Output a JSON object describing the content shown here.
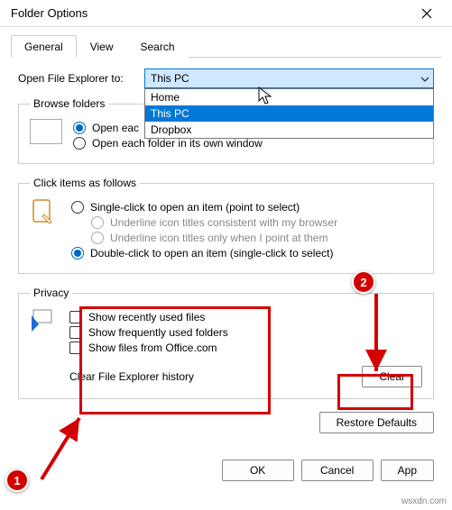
{
  "window": {
    "title": "Folder Options"
  },
  "tabs": {
    "general": "General",
    "view": "View",
    "search": "Search"
  },
  "open_row": {
    "label": "Open File Explorer to:",
    "selected": "This PC",
    "options": [
      "Home",
      "This PC",
      "Dropbox"
    ]
  },
  "browse": {
    "legend": "Browse folders",
    "same": "Open eac",
    "own": "Open each folder in its own window"
  },
  "click": {
    "legend": "Click items as follows",
    "single": "Single-click to open an item (point to select)",
    "underline_browser": "Underline icon titles consistent with my browser",
    "underline_point": "Underline icon titles only when I point at them",
    "double": "Double-click to open an item (single-click to select)"
  },
  "privacy": {
    "legend": "Privacy",
    "recent": "Show recently used files",
    "frequent": "Show frequently used folders",
    "office": "Show files from Office.com",
    "history_label": "Clear File Explorer history",
    "clear": "Clear"
  },
  "restore": "Restore Defaults",
  "buttons": {
    "ok": "OK",
    "cancel": "Cancel",
    "apply": "App"
  },
  "markers": {
    "m1": "1",
    "m2": "2"
  },
  "watermark": "wsxdn.com"
}
